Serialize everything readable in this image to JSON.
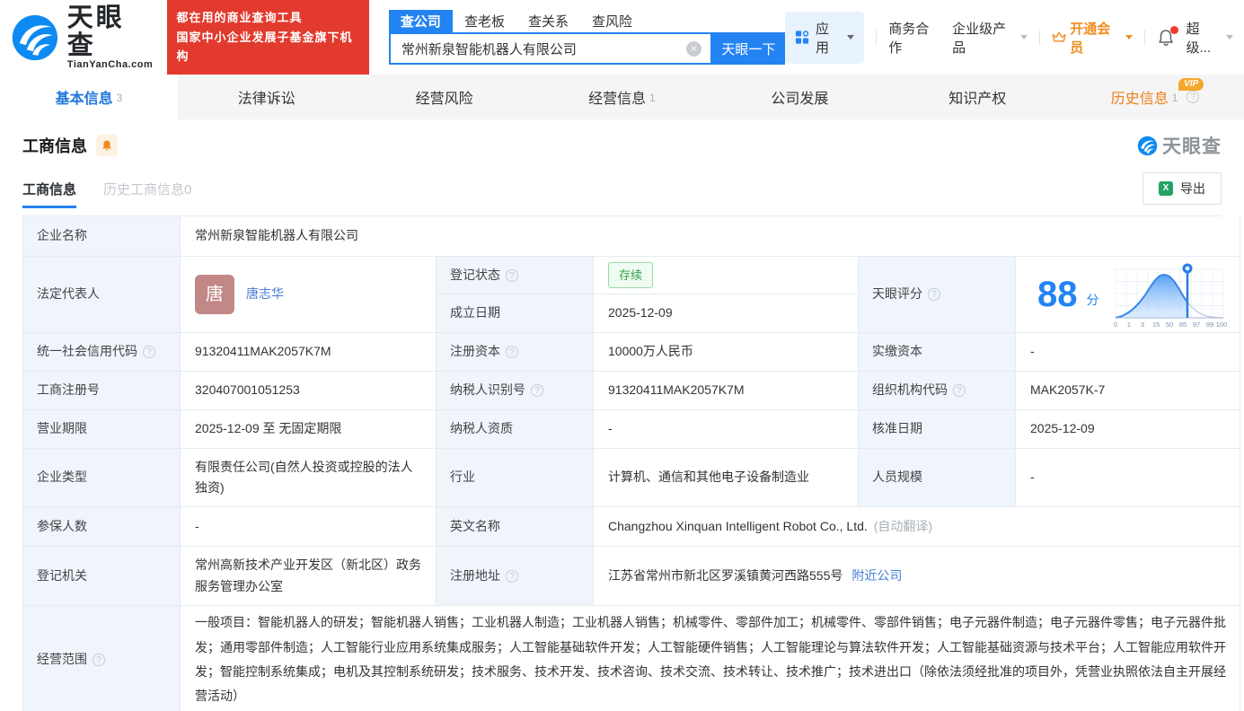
{
  "brand": {
    "name": "天眼查",
    "domain": "TianYanCha.com",
    "slogan1": "都在用的商业查询工具",
    "slogan2": "国家中小企业发展子基金旗下机构"
  },
  "search": {
    "tabs": [
      {
        "label": "查公司"
      },
      {
        "label": "查老板"
      },
      {
        "label": "查关系"
      },
      {
        "label": "查风险"
      }
    ],
    "value": "常州新泉智能机器人有限公司",
    "button": "天眼一下"
  },
  "topmenu": {
    "apps": "应用",
    "cooperation": "商务合作",
    "enterprise": "企业级产品",
    "vip": "开通会员",
    "super": "超级..."
  },
  "nav": {
    "tabs": [
      {
        "label": "基本信息",
        "count": "3"
      },
      {
        "label": "法律诉讼"
      },
      {
        "label": "经营风险"
      },
      {
        "label": "经营信息",
        "count": "1"
      },
      {
        "label": "公司发展"
      },
      {
        "label": "知识产权"
      },
      {
        "label": "历史信息",
        "count": "1",
        "vip": "VIP"
      }
    ]
  },
  "section": {
    "title": "工商信息",
    "watermark": "天眼查",
    "tab_current": "工商信息",
    "tab_history": "历史工商信息0",
    "export": "导出"
  },
  "icons": {
    "question": "?",
    "clear": "×",
    "excel": "X"
  },
  "info": {
    "company_name_label": "企业名称",
    "company_name": "常州新泉智能机器人有限公司",
    "legal_rep_label": "法定代表人",
    "legal_rep_initial": "唐",
    "legal_rep_name": "唐志华",
    "status_label": "登记状态",
    "status": "存续",
    "est_date_label": "成立日期",
    "est_date": "2025-12-09",
    "score_label": "天眼评分",
    "score": "88",
    "score_unit": "分",
    "uscc_label": "统一社会信用代码",
    "uscc": "91320411MAK2057K7M",
    "reg_capital_label": "注册资本",
    "reg_capital": "10000万人民币",
    "paid_capital_label": "实缴资本",
    "paid_capital": "-",
    "reg_no_label": "工商注册号",
    "reg_no": "320407001051253",
    "taxpayer_id_label": "纳税人识别号",
    "taxpayer_id": "91320411MAK2057K7M",
    "org_code_label": "组织机构代码",
    "org_code": "MAK2057K-7",
    "term_label": "营业期限",
    "term": "2025-12-09 至 无固定期限",
    "taxpayer_quality_label": "纳税人资质",
    "taxpayer_quality": "-",
    "approval_date_label": "核准日期",
    "approval_date": "2025-12-09",
    "company_type_label": "企业类型",
    "company_type": "有限责任公司(自然人投资或控股的法人独资)",
    "industry_label": "行业",
    "industry": "计算机、通信和其他电子设备制造业",
    "staff_size_label": "人员规模",
    "staff_size": "-",
    "insured_label": "参保人数",
    "insured": "-",
    "english_name_label": "英文名称",
    "english_name": "Changzhou Xinquan Intelligent Robot Co., Ltd.",
    "english_name_note": "(自动翻译)",
    "reg_authority_label": "登记机关",
    "reg_authority": "常州高新技术产业开发区（新北区）政务服务管理办公室",
    "address_label": "注册地址",
    "address": "江苏省常州市新北区罗溪镇黄河西路555号",
    "address_link": "附近公司",
    "scope_label": "经营范围",
    "scope": "一般项目：智能机器人的研发；智能机器人销售；工业机器人制造；工业机器人销售；机械零件、零部件加工；机械零件、零部件销售；电子元器件制造；电子元器件零售；电子元器件批发；通用零部件制造；人工智能行业应用系统集成服务；人工智能基础软件开发；人工智能硬件销售；人工智能理论与算法软件开发；人工智能基础资源与技术平台；人工智能应用软件开发；智能控制系统集成；电机及其控制系统研发；技术服务、技术开发、技术咨询、技术交流、技术转让、技术推广；技术进出口（除依法须经批准的项目外，凭营业执照依法自主开展经营活动）"
  },
  "score_chart": {
    "type": "area",
    "curve": "bell-distribution",
    "x_labels": [
      "0",
      "1",
      "3",
      "15",
      "50",
      "85",
      "97",
      "99",
      "100"
    ],
    "marker_value": 88
  },
  "colors": {
    "primary_blue": "#2483f2",
    "link_blue": "#447dd4",
    "orange": "#f08c1f",
    "red": "#e23a2e",
    "green": "#30a546",
    "label_bg": "#eff5fa",
    "border": "#e4ebf2"
  }
}
